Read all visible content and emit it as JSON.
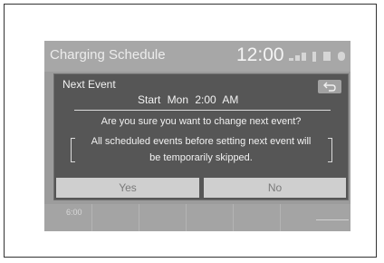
{
  "screen": {
    "title": "Charging Schedule",
    "clock": "12:00",
    "status_icons": [
      "signal-icon",
      "battery-icon"
    ]
  },
  "dialog": {
    "title": "Next Event",
    "start_line": "Start  Mon  2:00 AM",
    "question": "Are you sure you want to change next event?",
    "note_line1": "All scheduled events before setting next event will",
    "note_line2": "be temporarily skipped.",
    "yes_label": "Yes",
    "no_label": "No",
    "back_icon": "back-arrow-icon"
  },
  "schedule": {
    "time_label": "6:00"
  }
}
